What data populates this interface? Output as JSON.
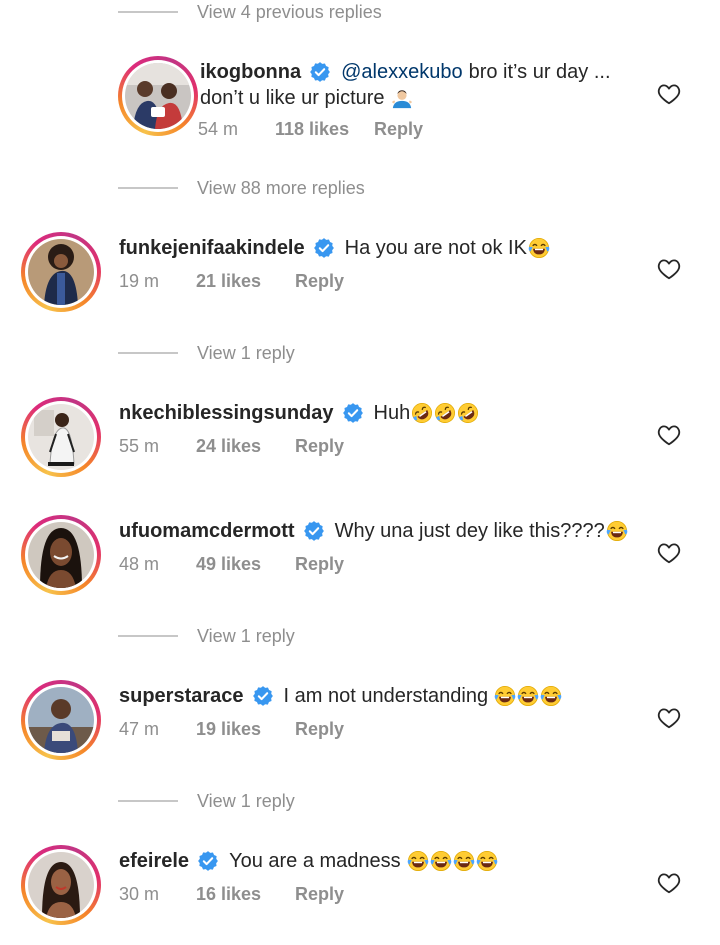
{
  "view_links": [
    "View 4 previous replies",
    "View 88 more replies",
    "View 1 reply",
    "View 1 reply",
    "View 1 reply"
  ],
  "comments": [
    {
      "username": "ikogbonna",
      "mention": "@alexxekubo",
      "text": "bro it’s ur day ...",
      "text_cont": "don’t u like ur picture",
      "emoji": "man-shrugging-emoji",
      "time": "54 m",
      "likes": "118 likes",
      "reply": "Reply"
    },
    {
      "username": "funkejenifaakindele",
      "text": "Ha you are not ok IK",
      "emoji": "face-with-tears-of-joy-emoji",
      "time": "19 m",
      "likes": "21 likes",
      "reply": "Reply"
    },
    {
      "username": "nkechiblessingsunday",
      "text": "Huh",
      "emoji": "rolling-on-floor-laughing-emoji x3",
      "time": "55 m",
      "likes": "24 likes",
      "reply": "Reply"
    },
    {
      "username": "ufuomamcdermott",
      "text": "Why una just dey like this????",
      "emoji": "face-with-tears-of-joy-emoji",
      "time": "48 m",
      "likes": "49 likes",
      "reply": "Reply"
    },
    {
      "username": "superstarace",
      "text": "I am not understanding",
      "emoji": "face-with-tears-of-joy-emoji x3",
      "time": "47 m",
      "likes": "19 likes",
      "reply": "Reply"
    },
    {
      "username": "efeirele",
      "text": "You are a madness",
      "emoji": "face-with-tears-of-joy-emoji x4",
      "time": "30 m",
      "likes": "16 likes",
      "reply": "Reply"
    }
  ],
  "colors": {
    "text": "#262626",
    "secondary": "#8e8e8e",
    "mention": "#00376b",
    "verified": "#3897f0"
  },
  "icons": [
    "verified-badge-icon",
    "heart-icon"
  ]
}
